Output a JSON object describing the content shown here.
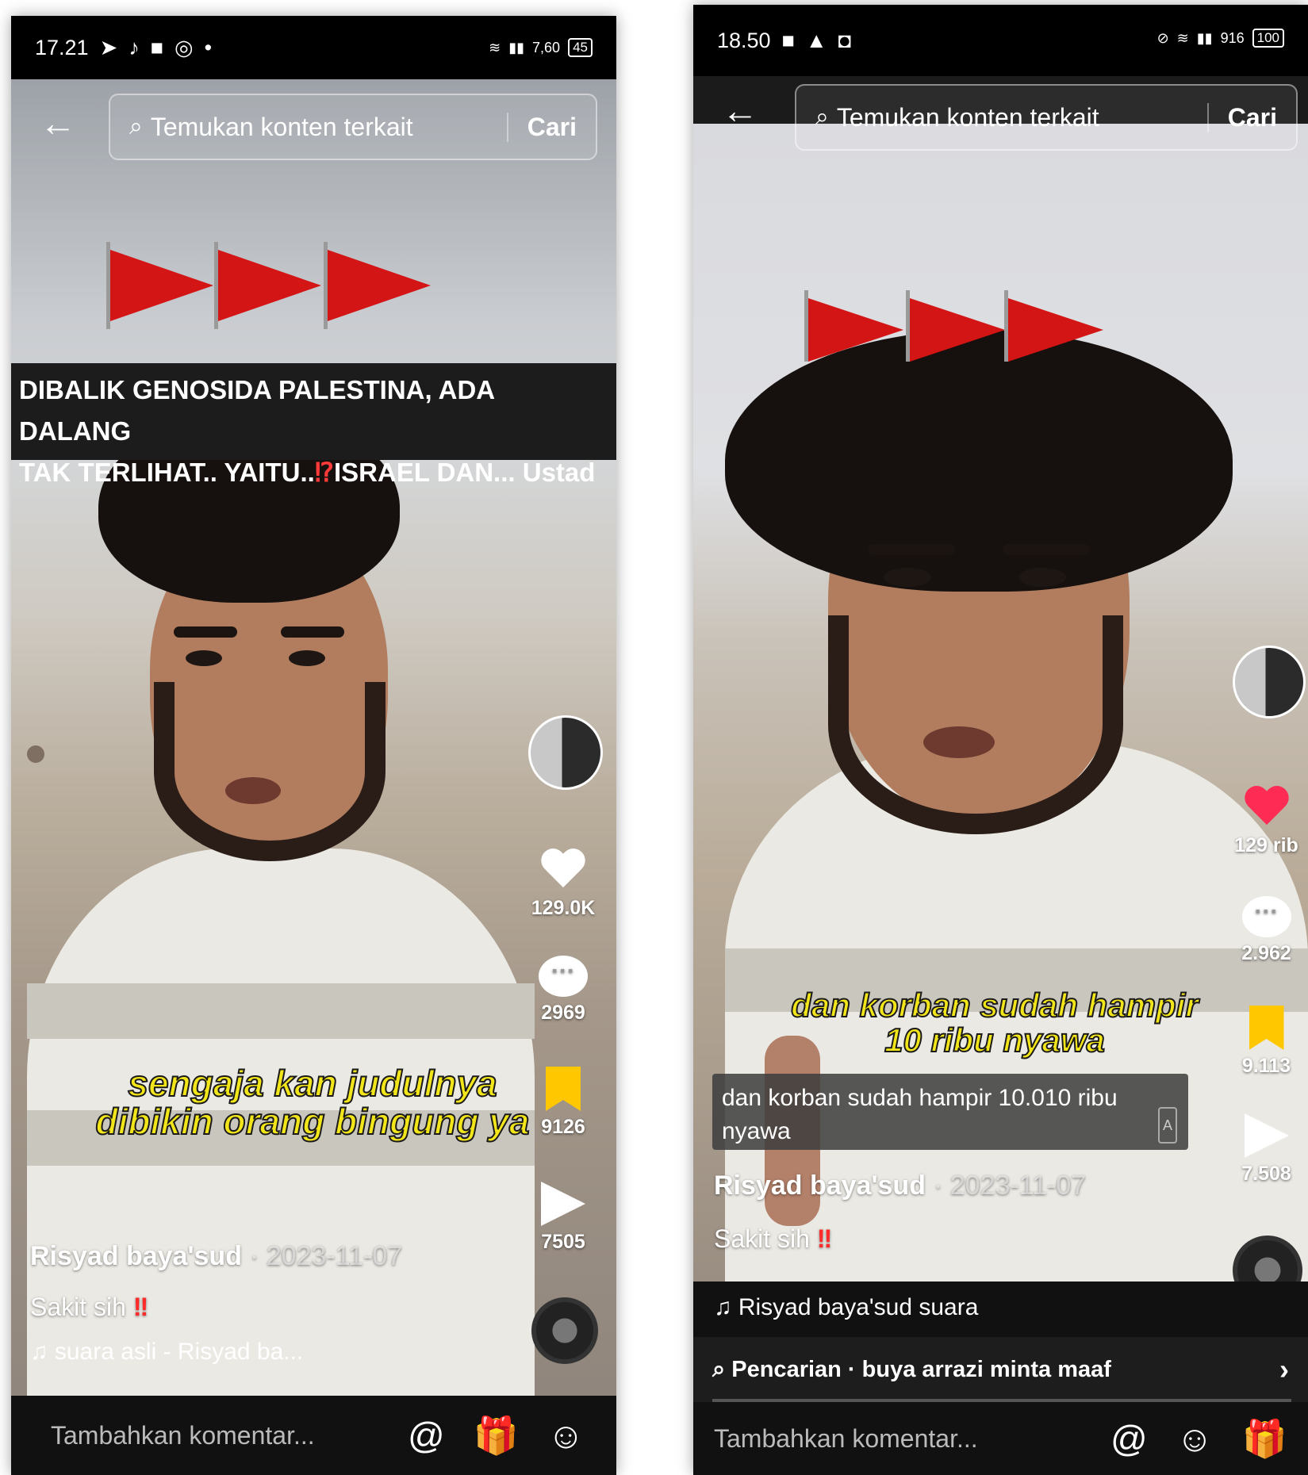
{
  "left": {
    "status": {
      "time": "17.21",
      "battery": "45",
      "speed": "7,60"
    },
    "search": {
      "placeholder": "Temukan konten terkait",
      "button": "Cari"
    },
    "title_line1": "DIBALIK GENOSIDA PALESTINA, ADA DALANG",
    "title_line2_a": "TAK TERLIHAT.. YAITU..",
    "title_line2_q": "⁉",
    "title_line2_b": "ISRAEL DAN... Ustad",
    "caption_line1": "sengaja kan judulnya",
    "caption_line2": "dibikin orang bingung ya",
    "likes": "129.0K",
    "comments": "2969",
    "saves": "9126",
    "shares": "7505",
    "author": "Risyad baya'sud",
    "date": "· 2023-11-07",
    "description": "Sakit sih",
    "description_mark": "‼",
    "sound": "♫ suara asli - Risyad ba...",
    "comment_placeholder": "Tambahkan komentar...",
    "at": "@",
    "gift": "🎁",
    "emoji": "☺"
  },
  "right": {
    "status": {
      "time": "18.50",
      "battery": "100",
      "speed": "916"
    },
    "search": {
      "placeholder": "Temukan konten terkait",
      "button": "Cari"
    },
    "caption_line1": "dan korban sudah hampir",
    "caption_line2": "10 ribu nyawa",
    "subtitle": "dan korban sudah hampir 10.010 ribu nyawa",
    "subtitle_badge": "A",
    "likes": "129 rib",
    "comments": "2.962",
    "saves": "9.113",
    "shares": "7.508",
    "author": "Risyad baya'sud",
    "date": "· 2023-11-07",
    "description": "Sakit sih",
    "description_mark": "‼",
    "sound": "♫ Risyad baya'sud   suara",
    "suggestion": "Pencarian · buya arrazi minta maaf",
    "comment_placeholder": "Tambahkan komentar...",
    "at": "@",
    "emoji": "☺",
    "gift": "🎁"
  },
  "colors": {
    "flag": "#d41515",
    "like_active": "#fe2c55",
    "bookmark": "#ffc700",
    "caption_yellow": "#f2e51a"
  }
}
